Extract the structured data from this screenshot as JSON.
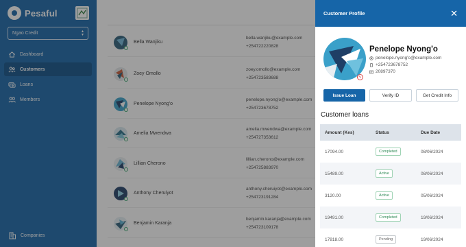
{
  "brand": {
    "name": "Pesaful"
  },
  "org_select": {
    "value": "Ngao Credit"
  },
  "nav": {
    "items": [
      {
        "label": "Dashboard",
        "icon": "home-icon",
        "active": false
      },
      {
        "label": "Customers",
        "icon": "users-icon",
        "active": true
      },
      {
        "label": "Loans",
        "icon": "money-icon",
        "active": false
      },
      {
        "label": "Members",
        "icon": "members-icon",
        "active": false
      }
    ],
    "bottom": {
      "label": "Companies",
      "icon": "building-icon"
    }
  },
  "customers": [
    {
      "name": "Bella Wanjiku",
      "email": "bella.wanjiku@example.com",
      "phone": "+254722220828"
    },
    {
      "name": "Zoey Omollo",
      "email": "zoey.omollo@example.com",
      "phone": "+254723583688"
    },
    {
      "name": "Penelope Nyong'o",
      "email": "penelope.nyong'o@example.com",
      "phone": "+254723678752"
    },
    {
      "name": "Amelia Mwendwa",
      "email": "amelia.mwendwa@example.com",
      "phone": "+254727353612"
    },
    {
      "name": "Lillian Cherono",
      "email": "lillian.cherono@example.com",
      "phone": "+254725883970"
    },
    {
      "name": "Anthony Cheruiyot",
      "email": "anthony.cheruiyot@example.com",
      "phone": "+254723191284"
    },
    {
      "name": "Benjamin Karanja",
      "email": "benjamin.karanja@example.com",
      "phone": "+254723109178"
    }
  ],
  "drawer": {
    "title": "Customer Profile",
    "name": "Penelope Nyong'o",
    "email": "penelope.nyong'o@example.com",
    "phone": "+254723678752",
    "id_number": "20897370",
    "buttons": {
      "issue": "Issue Loan",
      "verify": "Verify ID",
      "credit": "Get Credit Info"
    },
    "loans_title": "Customer loans",
    "columns": {
      "amount": "Amount (Kes)",
      "status": "Status",
      "due": "Due Date"
    },
    "loans": [
      {
        "amount": "17094.00",
        "status": "Completed",
        "due": "08/06/2024"
      },
      {
        "amount": "15489.00",
        "status": "Active",
        "due": "08/06/2024"
      },
      {
        "amount": "3120.00",
        "status": "Active",
        "due": "05/06/2024"
      },
      {
        "amount": "19491.00",
        "status": "Completed",
        "due": "19/06/2024"
      },
      {
        "amount": "17818.00",
        "status": "Pending",
        "due": "19/06/2024"
      }
    ]
  },
  "colors": {
    "primary": "#1665a8",
    "active_nav": "#0e4f88",
    "success": "#2f8a56"
  }
}
